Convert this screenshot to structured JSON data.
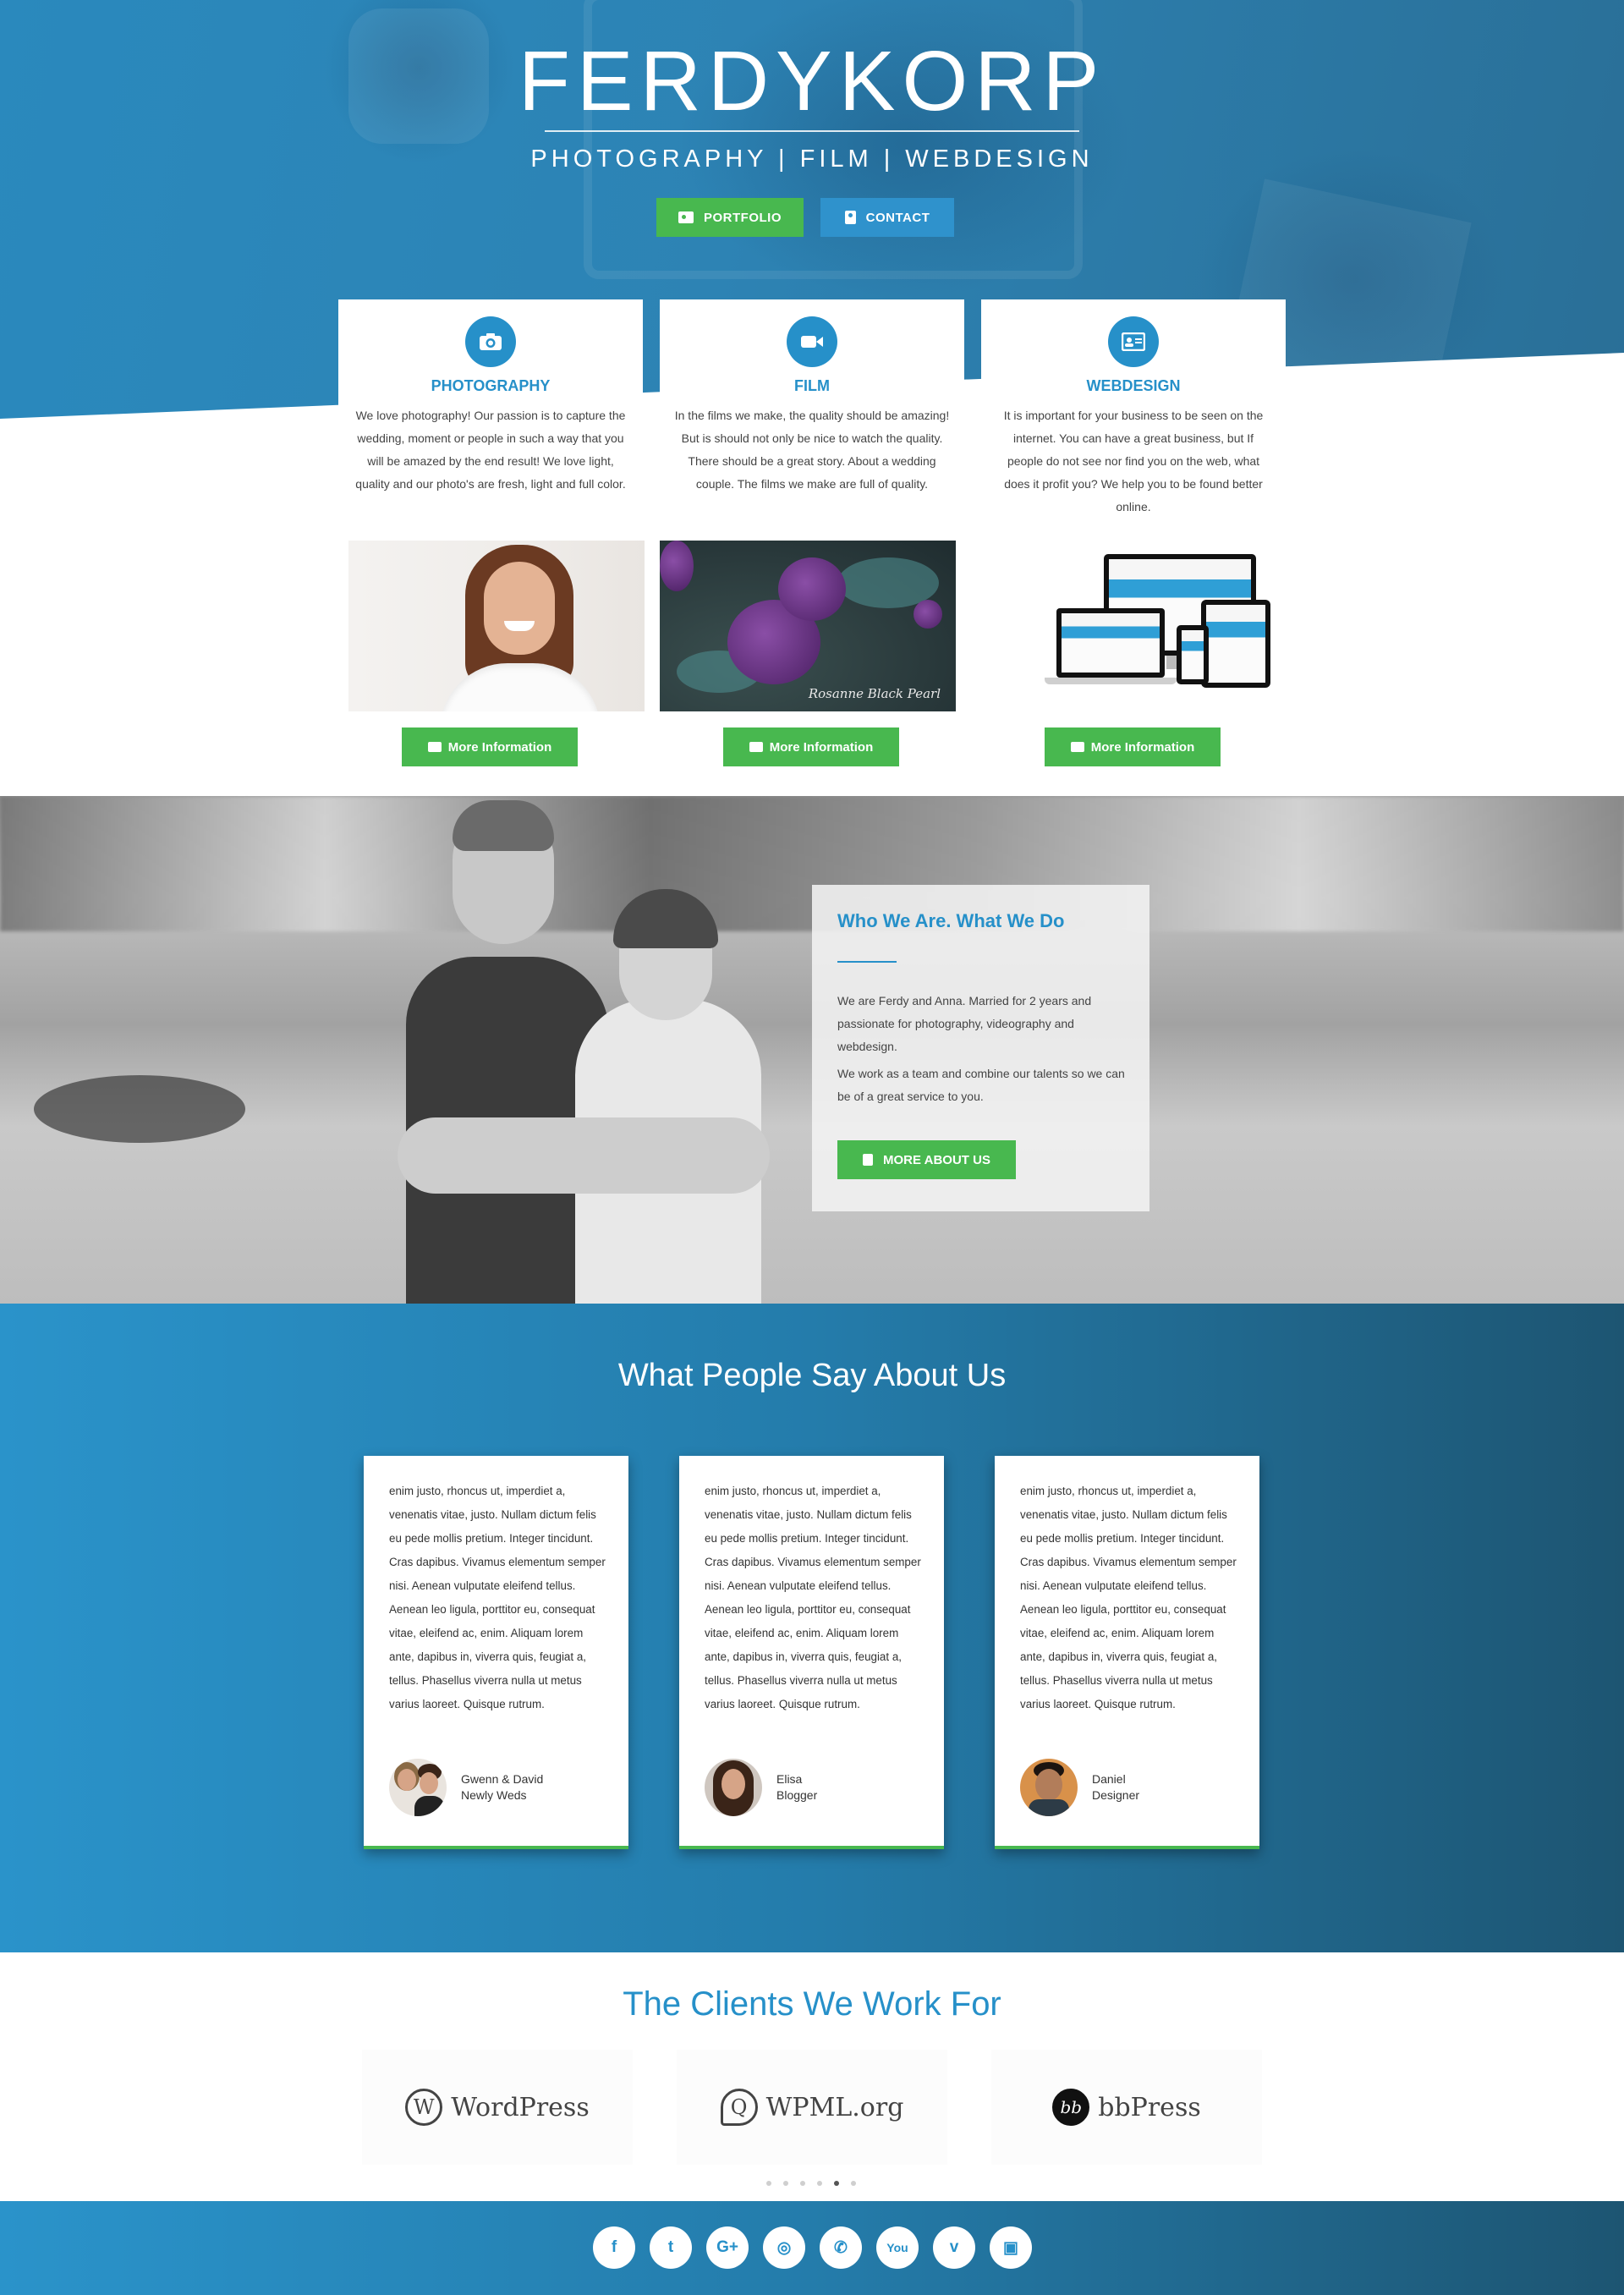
{
  "brand": {
    "name": "FERDYKORP",
    "tagline": "PHOTOGRAPHY | FILM | WEBDESIGN",
    "portfolio_label": "PORTFOLIO",
    "contact_label": "CONTACT"
  },
  "services": [
    {
      "icon": "camera-icon",
      "title": "PHOTOGRAPHY",
      "description": "We love photography! Our passion is to capture the wedding, moment or people in such a way that you will be amazed by the end result! We love light, quality and our photo's are fresh, light and full color.",
      "button": "More Information"
    },
    {
      "icon": "video-camera-icon",
      "title": "FILM",
      "description": "In the films we make, the quality should be amazing! But is should not only be nice to watch the quality. There should be a great story. About a wedding couple. The films we make are full of quality.",
      "button": "More Information",
      "image_caption": "Rosanne Black Pearl"
    },
    {
      "icon": "id-card-icon",
      "title": "WEBDESIGN",
      "description": "It is important for your business to be seen on the internet. You can have a great business, but If people do not see nor find you on the web, what does it profit you? We help you to be found better online.",
      "button": "More Information"
    }
  ],
  "about": {
    "title": "Who We Are. What We Do",
    "paragraph1": "We are Ferdy and Anna. Married for 2 years and passionate for photography, videography and webdesign.",
    "paragraph2": "We work as a team and combine our talents so we can be of a great service to you.",
    "button": "MORE ABOUT US"
  },
  "testimonials": {
    "heading": "What People Say About Us",
    "items": [
      {
        "quote": "enim justo, rhoncus ut, imperdiet a, venenatis vitae, justo. Nullam dictum felis eu pede mollis pretium. Integer tincidunt. Cras dapibus. Vivamus elementum semper nisi. Aenean vulputate eleifend tellus. Aenean leo ligula, porttitor eu, consequat vitae, eleifend ac, enim. Aliquam lorem ante, dapibus in, viverra quis, feugiat a, tellus. Phasellus viverra nulla ut metus varius laoreet. Quisque rutrum.",
        "name": "Gwenn & David",
        "role": "Newly Weds"
      },
      {
        "quote": "enim justo, rhoncus ut, imperdiet a, venenatis vitae, justo. Nullam dictum felis eu pede mollis pretium. Integer tincidunt. Cras dapibus. Vivamus elementum semper nisi. Aenean vulputate eleifend tellus. Aenean leo ligula, porttitor eu, consequat vitae, eleifend ac, enim. Aliquam lorem ante, dapibus in, viverra quis, feugiat a, tellus. Phasellus viverra nulla ut metus varius laoreet. Quisque rutrum.",
        "name": "Elisa",
        "role": "Blogger"
      },
      {
        "quote": "enim justo, rhoncus ut, imperdiet a, venenatis vitae, justo. Nullam dictum felis eu pede mollis pretium. Integer tincidunt. Cras dapibus. Vivamus elementum semper nisi. Aenean vulputate eleifend tellus. Aenean leo ligula, porttitor eu, consequat vitae, eleifend ac, enim. Aliquam lorem ante, dapibus in, viverra quis, feugiat a, tellus. Phasellus viverra nulla ut metus varius laoreet. Quisque rutrum.",
        "name": "Daniel",
        "role": "Designer"
      }
    ]
  },
  "clients": {
    "heading": "The Clients We Work For",
    "logos": [
      {
        "mark": "W",
        "text": "WordPress"
      },
      {
        "mark": "Q",
        "text": "WPML.org"
      },
      {
        "mark": "bb",
        "text": "bbPress"
      }
    ],
    "carousel_dots": 6,
    "carousel_active_index": 4
  },
  "footer": {
    "social": [
      {
        "icon": "facebook-icon",
        "glyph": "f"
      },
      {
        "icon": "twitter-icon",
        "glyph": "t"
      },
      {
        "icon": "google-plus-icon",
        "glyph": "G+"
      },
      {
        "icon": "instagram-icon",
        "glyph": "◎"
      },
      {
        "icon": "whatsapp-icon",
        "glyph": "✆"
      },
      {
        "icon": "youtube-icon",
        "glyph": "You"
      },
      {
        "icon": "vimeo-icon",
        "glyph": "v"
      },
      {
        "icon": "twitch-icon",
        "glyph": "▣"
      }
    ]
  },
  "colors": {
    "primary_blue": "#2690c9",
    "green": "#48b84f",
    "dark_blue": "#1d5572"
  }
}
